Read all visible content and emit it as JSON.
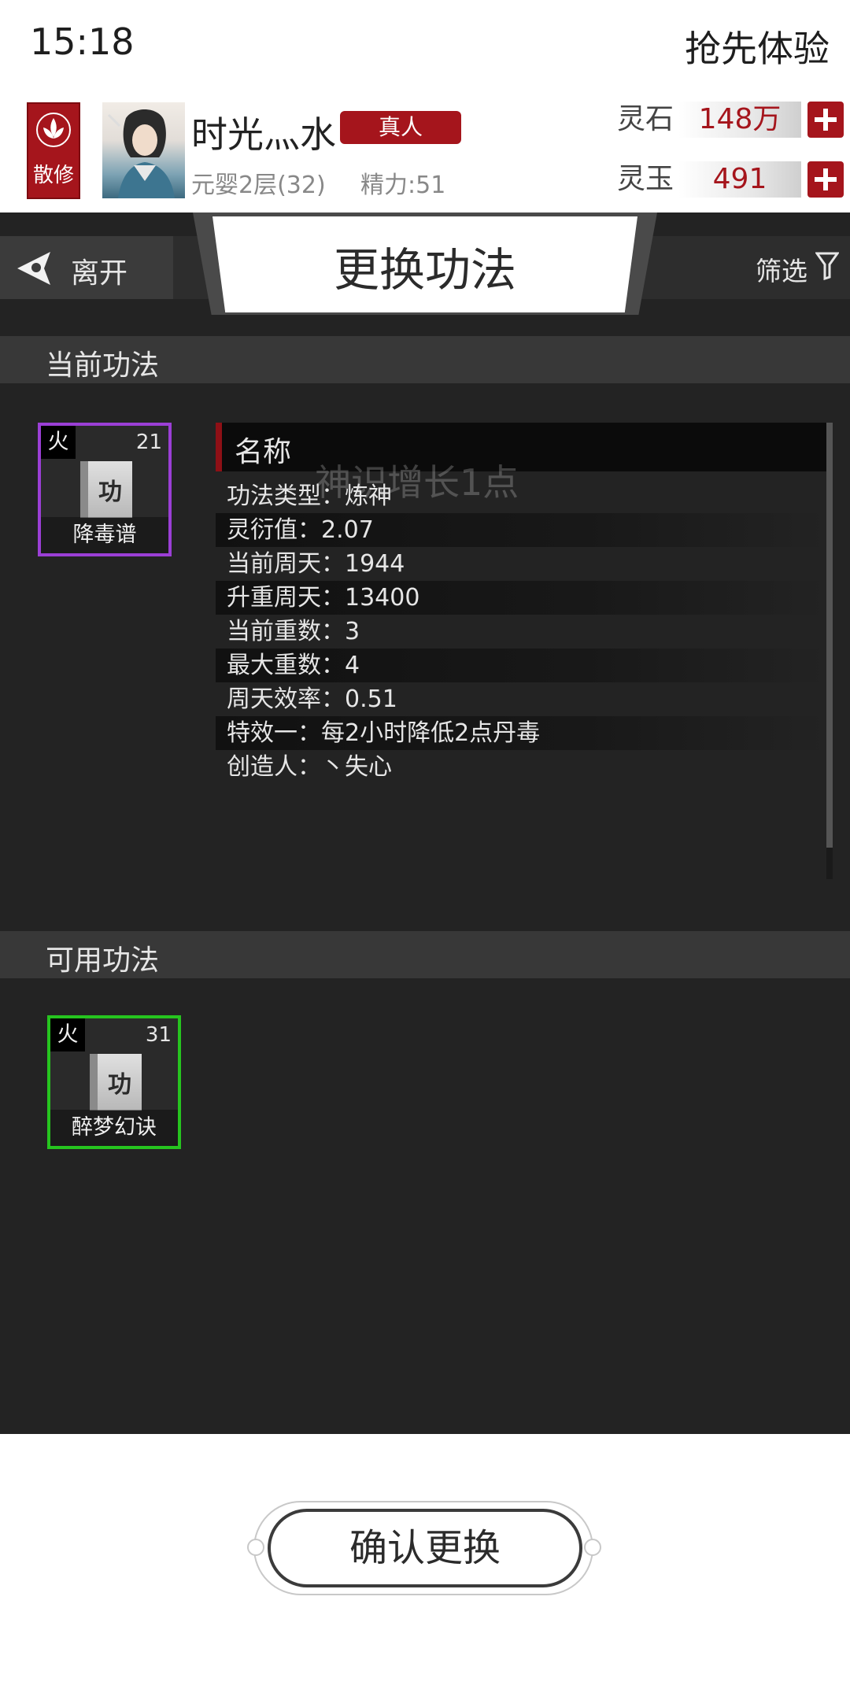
{
  "status_bar": {
    "time": "15:18",
    "right_text": "抢先体验"
  },
  "player": {
    "sect": "散修",
    "name": "时光灬水",
    "badge": "真人",
    "realm": "元婴2层(32)",
    "energy": "精力:51"
  },
  "resources": [
    {
      "label": "灵石",
      "value": "148万"
    },
    {
      "label": "灵玉",
      "value": "491"
    }
  ],
  "nav": {
    "back_label": "离开",
    "title": "更换功法",
    "filter_label": "筛选"
  },
  "current_section": {
    "title": "当前功法",
    "skill": {
      "element": "火",
      "level": "21",
      "name": "降毒谱",
      "book_char": "功"
    },
    "detail": {
      "header": "名称",
      "ghost_text": "神识增长1点",
      "rows": [
        "功法类型：炼神",
        "灵衍值：2.07",
        "当前周天：1944",
        "升重周天：13400",
        "当前重数：3",
        "最大重数：4",
        "周天效率：0.51",
        "特效一：每2小时降低2点丹毒",
        "创造人：丶失心"
      ]
    }
  },
  "available_section": {
    "title": "可用功法",
    "skills": [
      {
        "element": "火",
        "level": "31",
        "name": "醉梦幻诀",
        "book_char": "功"
      }
    ]
  },
  "confirm_label": "确认更换",
  "colors": {
    "accent_red": "#a5151c",
    "current_border": "#9b3fd6",
    "available_border": "#26c41f",
    "dark_bg": "#232323"
  }
}
